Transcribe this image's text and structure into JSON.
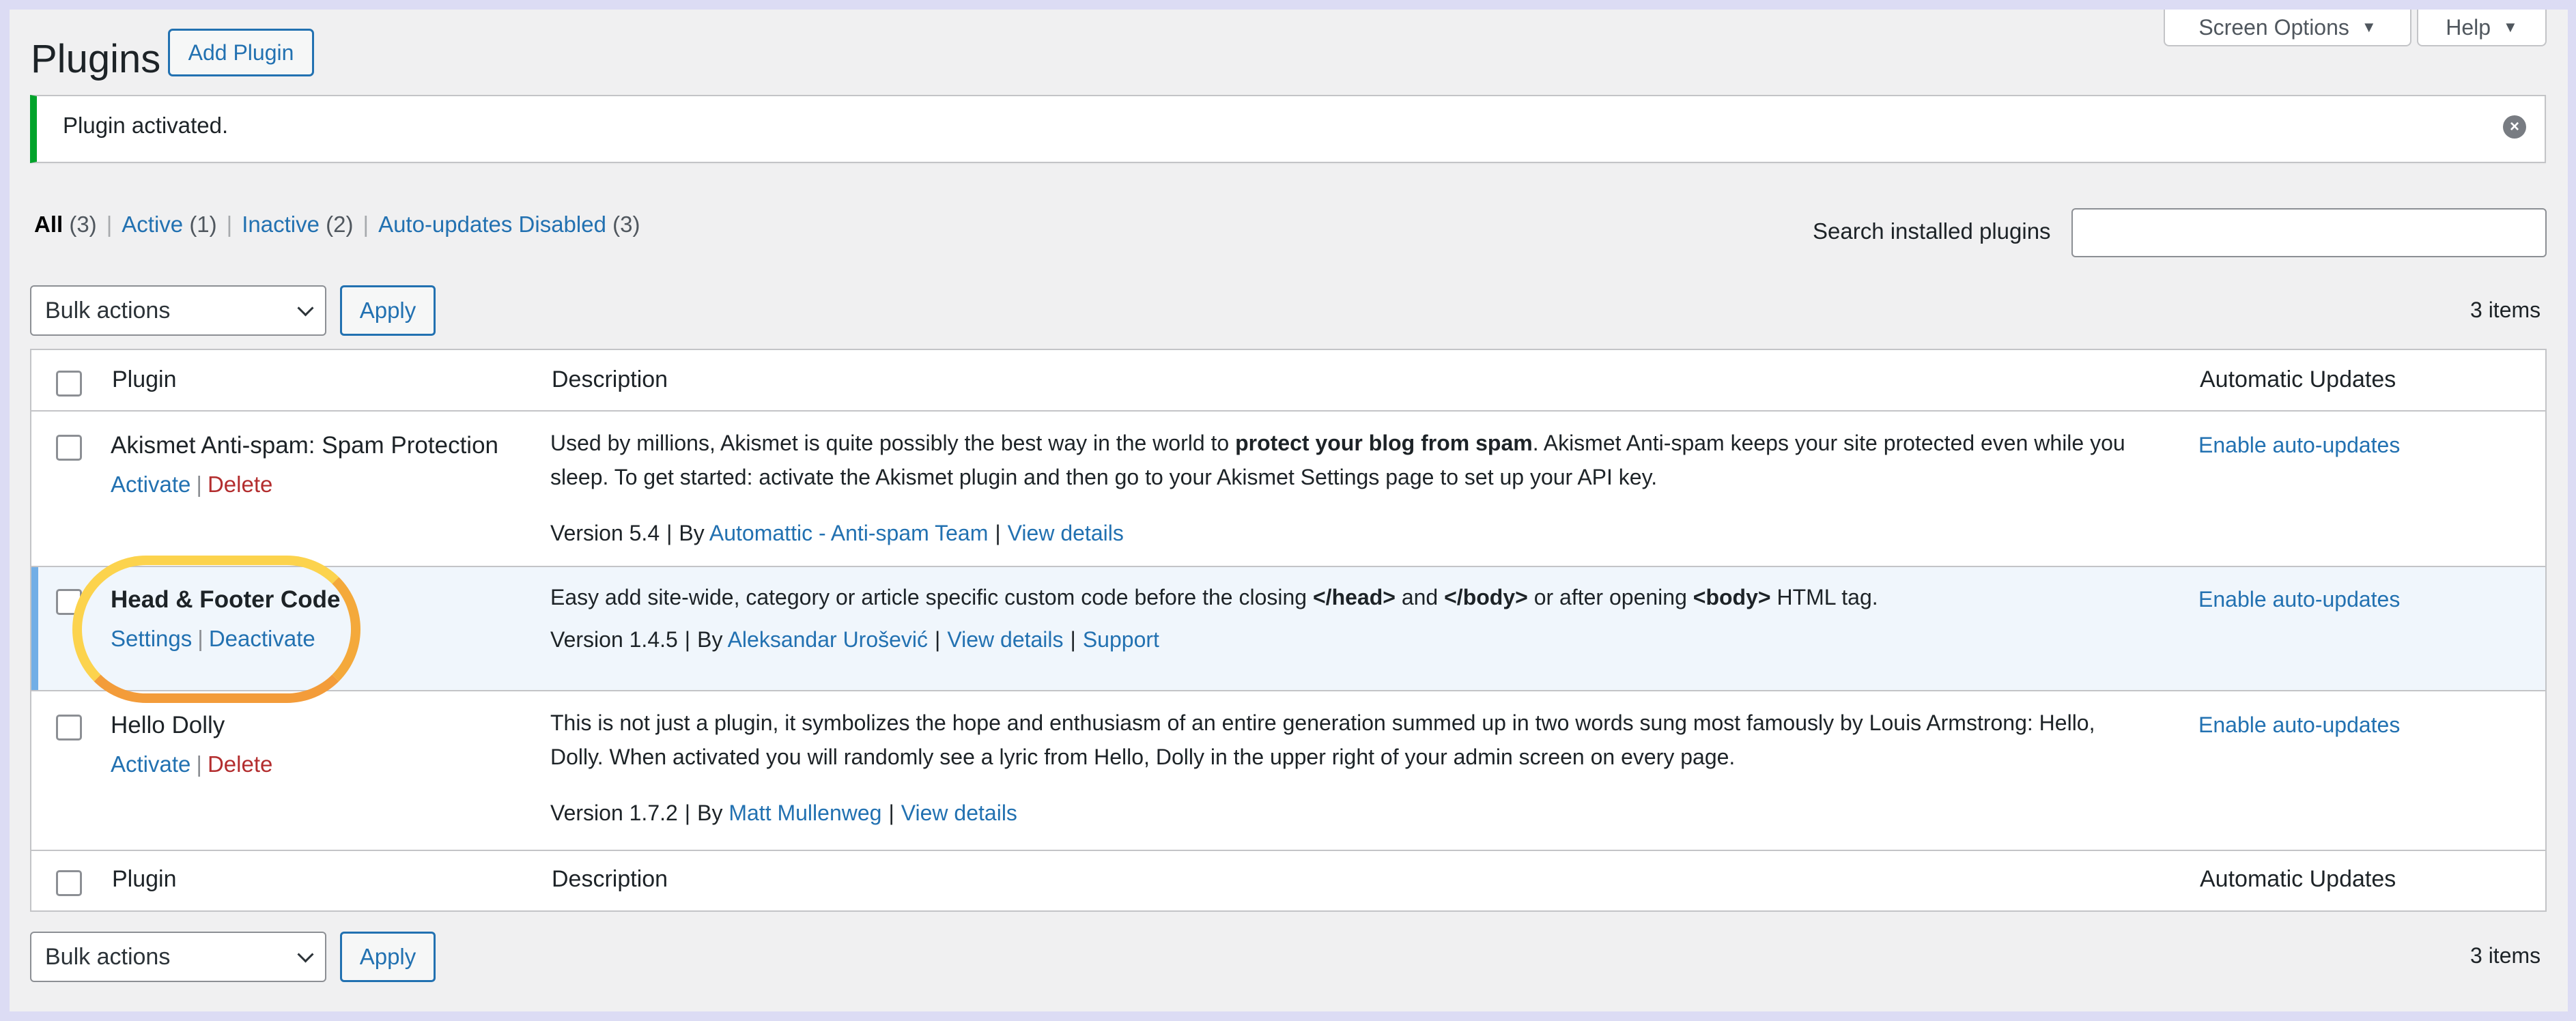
{
  "header": {
    "title": "Plugins",
    "add_button": "Add Plugin",
    "screen_options": "Screen Options",
    "help": "Help"
  },
  "notice": {
    "text": "Plugin activated."
  },
  "filters": {
    "all_label": "All",
    "all_count": "(3)",
    "active_label": "Active",
    "active_count": "(1)",
    "inactive_label": "Inactive",
    "inactive_count": "(2)",
    "auto_label": "Auto-updates Disabled",
    "auto_count": "(3)",
    "separator": "|"
  },
  "search": {
    "label": "Search installed plugins",
    "value": ""
  },
  "bulk": {
    "select_value": "Bulk actions",
    "apply": "Apply",
    "items_count": "3 items"
  },
  "table": {
    "columns": {
      "plugin": "Plugin",
      "description": "Description",
      "auto_updates": "Automatic Updates"
    },
    "rows": [
      {
        "name": "Akismet Anti-spam: Spam Protection",
        "action1": "Activate",
        "action2": "Delete",
        "desc_part1": "Used by millions, Akismet is quite possibly the best way in the world to ",
        "desc_bold1": "protect your blog from spam",
        "desc_part2": ". Akismet Anti-spam keeps your site protected even while you sleep. To get started: activate the Akismet plugin and then go to your Akismet Settings page to set up your API key.",
        "version": "Version 5.4",
        "by": "By",
        "author": "Automattic - Anti-spam Team",
        "details": "View details",
        "auto": "Enable auto-updates"
      },
      {
        "name": "Head & Footer Code",
        "action1": "Settings",
        "action2": "Deactivate",
        "desc_part1": "Easy add site-wide, category or article specific custom code before the closing ",
        "desc_bold1": "</head>",
        "desc_part2": " and ",
        "desc_bold2": "</body>",
        "desc_part3": " or after opening ",
        "desc_bold3": "<body>",
        "desc_part4": " HTML tag.",
        "version": "Version 1.4.5",
        "by": "By",
        "author": "Aleksandar Urošević",
        "details": "View details",
        "support": "Support",
        "auto": "Enable auto-updates"
      },
      {
        "name": "Hello Dolly",
        "action1": "Activate",
        "action2": "Delete",
        "desc_part1": "This is not just a plugin, it symbolizes the hope and enthusiasm of an entire generation summed up in two words sung most famously by Louis Armstrong: Hello, Dolly. When activated you will randomly see a lyric from Hello, Dolly in the upper right of your admin screen on every page.",
        "version": "Version 1.7.2",
        "by": "By",
        "author": "Matt Mullenweg",
        "details": "View details",
        "auto": "Enable auto-updates"
      }
    ]
  },
  "icons": {
    "dismiss": "dismiss-icon",
    "dropdown": "chevron-down-icon",
    "triangle": "triangle-down-icon"
  },
  "colors": {
    "link": "#2271b1",
    "delete": "#b32d2e",
    "notice_success": "#00a32a",
    "active_row_border": "#72aee6",
    "highlight": "#f9b233"
  }
}
